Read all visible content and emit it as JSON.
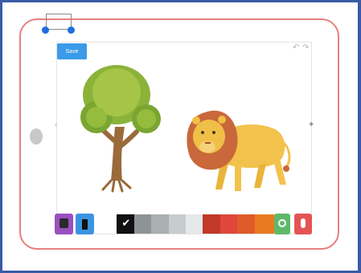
{
  "app": {
    "save_label": "Save"
  },
  "colors": {
    "frame": "#3a5aa8",
    "tablet_outline": "#e87f7f",
    "selection_handle": "#1e6fe0",
    "save_button": "#3b9be8"
  },
  "icons": {
    "undo": "undo-icon",
    "redo": "redo-icon",
    "prev": "chevron-left-icon",
    "next": "chevron-right-icon",
    "erase": "eraser-icon",
    "marker": "marker-icon",
    "sticker": "sticker-icon",
    "record": "microphone-icon"
  },
  "palette": [
    {
      "name": "white",
      "color": "#ffffff",
      "selected": false
    },
    {
      "name": "black",
      "color": "#111111",
      "selected": true
    },
    {
      "name": "dark-gray",
      "color": "#8d9496",
      "selected": false
    },
    {
      "name": "gray",
      "color": "#a9b0b2",
      "selected": false
    },
    {
      "name": "light-gray",
      "color": "#c7ccce",
      "selected": false
    },
    {
      "name": "pale-gray",
      "color": "#e6e9ea",
      "selected": false
    },
    {
      "name": "dark-red",
      "color": "#c0392b",
      "selected": false
    },
    {
      "name": "red",
      "color": "#e0463b",
      "selected": false
    },
    {
      "name": "orange-red",
      "color": "#e05a2a",
      "selected": false
    },
    {
      "name": "orange",
      "color": "#ea7a20",
      "selected": false
    }
  ],
  "canvas": {
    "drawings": [
      "tree",
      "lion"
    ]
  }
}
